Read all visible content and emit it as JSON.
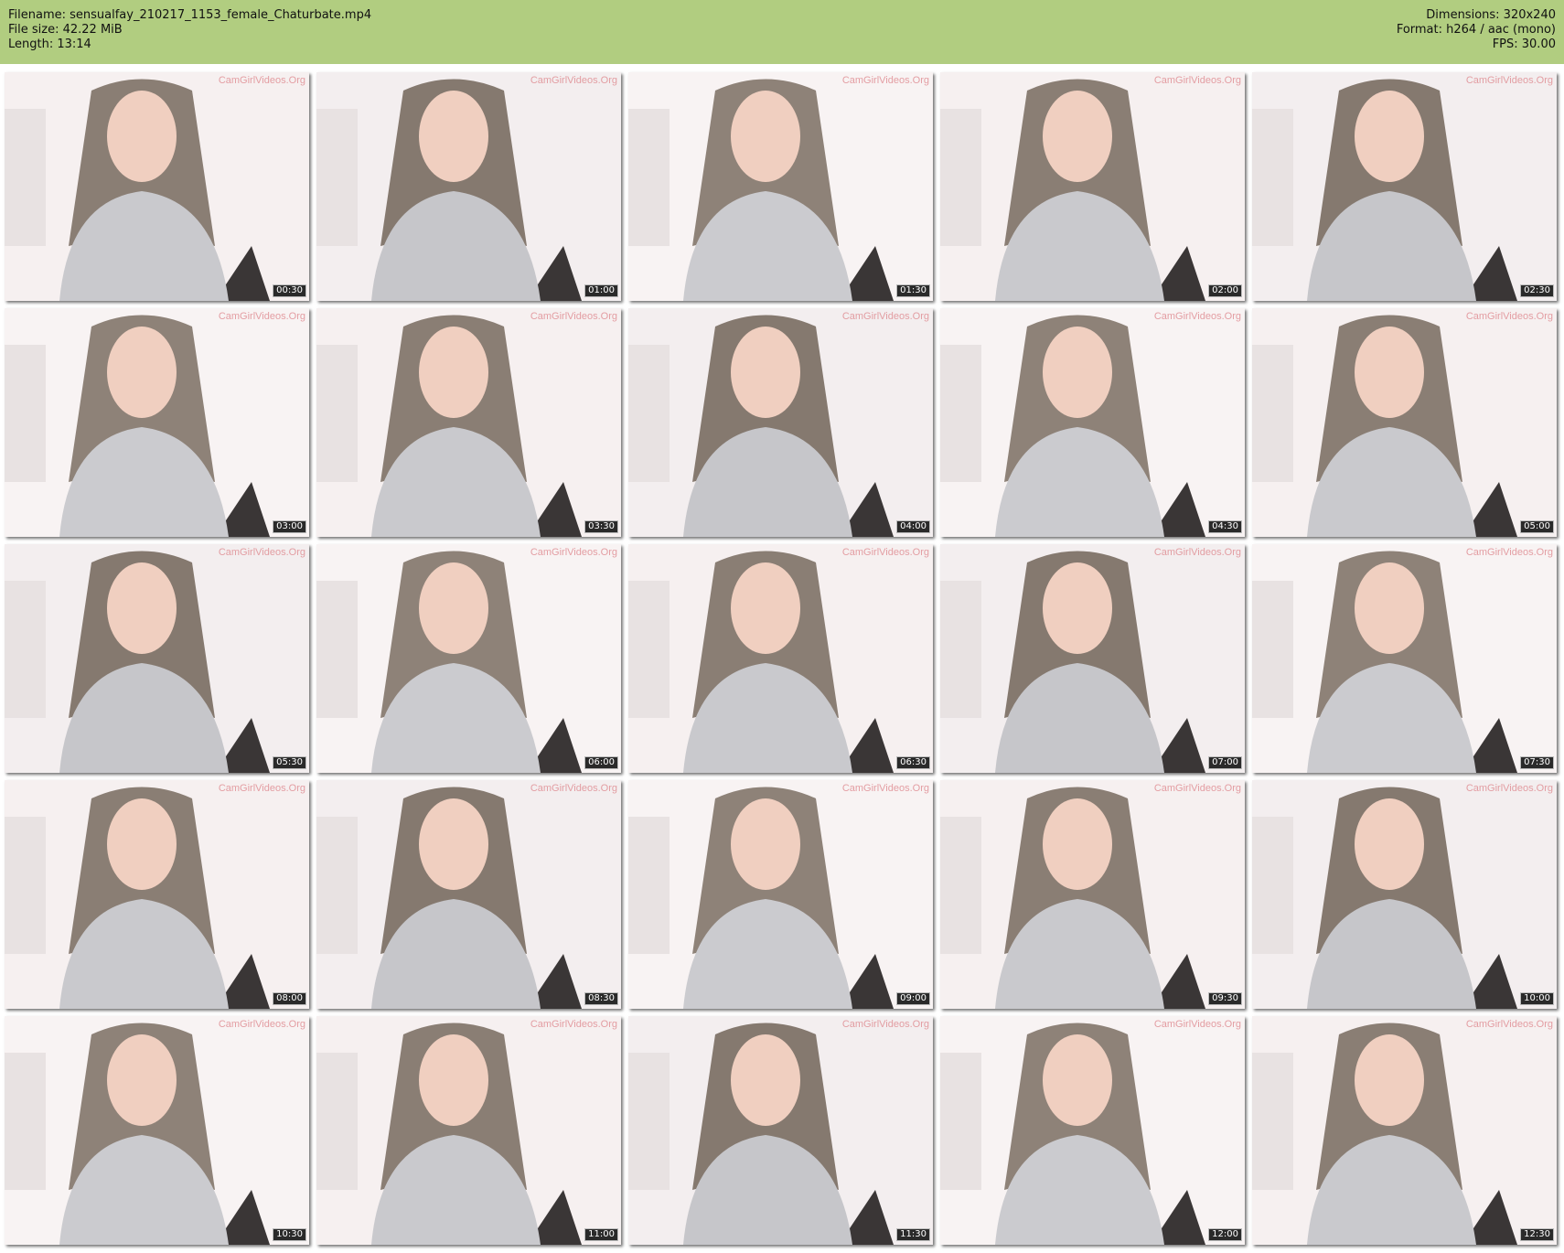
{
  "header": {
    "filename": "Filename: sensualfay_210217_1153_female_Chaturbate.mp4",
    "filesize": "File size: 42.22 MiB",
    "length": "Length: 13:14",
    "dimensions": "Dimensions: 320x240",
    "format": "Format: h264 / aac (mono)",
    "fps": "FPS: 30.00",
    "bg_color": "#b1cd80"
  },
  "thumbnails": [
    {
      "time": "00:30",
      "watermark": "CamGirlVideos.Org"
    },
    {
      "time": "01:00",
      "watermark": "CamGirlVideos.Org"
    },
    {
      "time": "01:30",
      "watermark": "CamGirlVideos.Org"
    },
    {
      "time": "02:00",
      "watermark": "CamGirlVideos.Org"
    },
    {
      "time": "02:30",
      "watermark": "CamGirlVideos.Org"
    },
    {
      "time": "03:00",
      "watermark": "CamGirlVideos.Org"
    },
    {
      "time": "03:30",
      "watermark": "CamGirlVideos.Org"
    },
    {
      "time": "04:00",
      "watermark": "CamGirlVideos.Org"
    },
    {
      "time": "04:30",
      "watermark": "CamGirlVideos.Org"
    },
    {
      "time": "05:00",
      "watermark": "CamGirlVideos.Org"
    },
    {
      "time": "05:30",
      "watermark": "CamGirlVideos.Org"
    },
    {
      "time": "06:00",
      "watermark": "CamGirlVideos.Org"
    },
    {
      "time": "06:30",
      "watermark": "CamGirlVideos.Org"
    },
    {
      "time": "07:00",
      "watermark": "CamGirlVideos.Org"
    },
    {
      "time": "07:30",
      "watermark": "CamGirlVideos.Org"
    },
    {
      "time": "08:00",
      "watermark": "CamGirlVideos.Org"
    },
    {
      "time": "08:30",
      "watermark": "CamGirlVideos.Org"
    },
    {
      "time": "09:00",
      "watermark": "CamGirlVideos.Org"
    },
    {
      "time": "09:30",
      "watermark": "CamGirlVideos.Org"
    },
    {
      "time": "10:00",
      "watermark": "CamGirlVideos.Org"
    },
    {
      "time": "10:30",
      "watermark": "CamGirlVideos.Org"
    },
    {
      "time": "11:00",
      "watermark": "CamGirlVideos.Org"
    },
    {
      "time": "11:30",
      "watermark": "CamGirlVideos.Org"
    },
    {
      "time": "12:00",
      "watermark": "CamGirlVideos.Org"
    },
    {
      "time": "12:30",
      "watermark": "CamGirlVideos.Org"
    }
  ]
}
